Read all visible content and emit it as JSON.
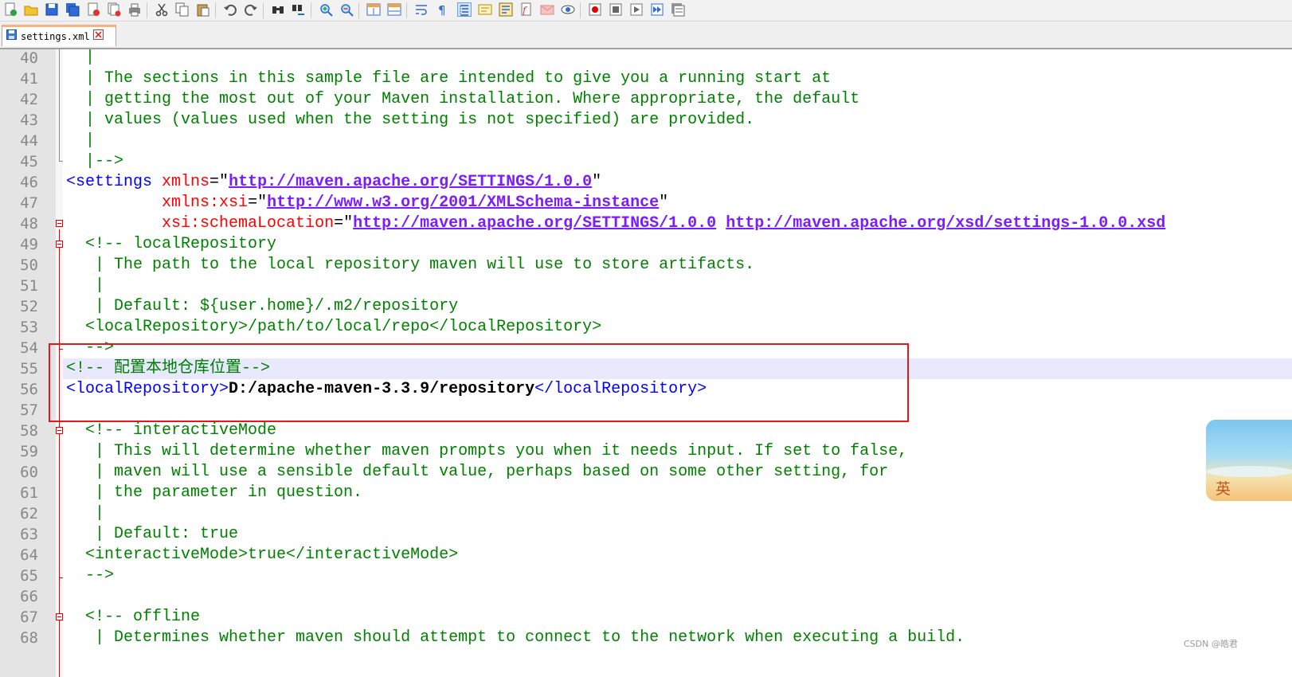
{
  "tab": {
    "filename": "settings.xml"
  },
  "toolbar_icons": [
    "new-file-icon",
    "open-file-icon",
    "save-icon",
    "save-all-icon",
    "close-icon",
    "close-all-icon",
    "print-icon",
    "cut-icon",
    "copy-icon",
    "paste-icon",
    "undo-icon",
    "redo-icon",
    "find-icon",
    "replace-icon",
    "zoom-in-icon",
    "zoom-out-icon",
    "sync-vertical-icon",
    "sync-horizontal-icon",
    "word-wrap-icon",
    "show-all-chars-icon",
    "indent-guide-icon",
    "doc-map-icon",
    "function-list-icon",
    "folder-workspace-icon",
    "monitoring-icon",
    "eye-icon",
    "record-macro-icon",
    "stop-record-icon",
    "play-macro-icon",
    "run-macro-multiple-icon",
    "save-macro-icon"
  ],
  "lines": [
    {
      "n": "40",
      "parts": [
        {
          "t": "  |",
          "c": "cm"
        }
      ]
    },
    {
      "n": "41",
      "parts": [
        {
          "t": "  | The sections in this sample file are intended to give you a running start at",
          "c": "cm"
        }
      ]
    },
    {
      "n": "42",
      "parts": [
        {
          "t": "  | getting the most out of your Maven installation. Where appropriate, the default",
          "c": "cm"
        }
      ]
    },
    {
      "n": "43",
      "parts": [
        {
          "t": "  | values (values used when the setting is not specified) are provided.",
          "c": "cm"
        }
      ]
    },
    {
      "n": "44",
      "parts": [
        {
          "t": "  |",
          "c": "cm"
        }
      ]
    },
    {
      "n": "45",
      "parts": [
        {
          "t": "  |-->",
          "c": "cm"
        }
      ]
    },
    {
      "n": "46",
      "parts": [
        {
          "t": "<settings ",
          "c": "tg"
        },
        {
          "t": "xmlns",
          "c": "at"
        },
        {
          "t": "=\"",
          "c": "eq"
        },
        {
          "t": "http://maven.apache.org/SETTINGS/1.0.0",
          "c": "lk"
        },
        {
          "t": "\"",
          "c": "eq"
        }
      ]
    },
    {
      "n": "47",
      "parts": [
        {
          "t": "          ",
          "c": "eq"
        },
        {
          "t": "xmlns:xsi",
          "c": "at"
        },
        {
          "t": "=\"",
          "c": "eq"
        },
        {
          "t": "http://www.w3.org/2001/XMLSchema-instance",
          "c": "lk"
        },
        {
          "t": "\"",
          "c": "eq"
        }
      ]
    },
    {
      "n": "48",
      "parts": [
        {
          "t": "          ",
          "c": "eq"
        },
        {
          "t": "xsi:schemaLocation",
          "c": "at"
        },
        {
          "t": "=\"",
          "c": "eq"
        },
        {
          "t": "http://maven.apache.org/SETTINGS/1.0.0",
          "c": "lk"
        },
        {
          "t": " ",
          "c": "eq"
        },
        {
          "t": "http://maven.apache.org/xsd/settings-1.0.0.xsd",
          "c": "lk"
        }
      ]
    },
    {
      "n": "49",
      "parts": [
        {
          "t": "  <!-- localRepository",
          "c": "cm"
        }
      ]
    },
    {
      "n": "50",
      "parts": [
        {
          "t": "   | The path to the local repository maven will use to store artifacts.",
          "c": "cm"
        }
      ]
    },
    {
      "n": "51",
      "parts": [
        {
          "t": "   |",
          "c": "cm"
        }
      ]
    },
    {
      "n": "52",
      "parts": [
        {
          "t": "   | Default: ${user.home}/.m2/repository",
          "c": "cm"
        }
      ]
    },
    {
      "n": "53",
      "parts": [
        {
          "t": "  <localRepository>/path/to/local/repo</localRepository>",
          "c": "cm"
        }
      ]
    },
    {
      "n": "54",
      "parts": [
        {
          "t": "  -->",
          "c": "cm"
        }
      ]
    },
    {
      "n": "55",
      "parts": [
        {
          "t": "<!-- 配置本地仓库位置-->",
          "c": "cm"
        }
      ]
    },
    {
      "n": "56",
      "parts": [
        {
          "t": "<localRepository>",
          "c": "tg"
        },
        {
          "t": "D:/apache-maven-3.3.9/repository",
          "c": "bk"
        },
        {
          "t": "</localRepository>",
          "c": "tg"
        }
      ]
    },
    {
      "n": "57",
      "parts": []
    },
    {
      "n": "58",
      "parts": [
        {
          "t": "  <!-- interactiveMode",
          "c": "cm"
        }
      ]
    },
    {
      "n": "59",
      "parts": [
        {
          "t": "   | This will determine whether maven prompts you when it needs input. If set to false,",
          "c": "cm"
        }
      ]
    },
    {
      "n": "60",
      "parts": [
        {
          "t": "   | maven will use a sensible default value, perhaps based on some other setting, for",
          "c": "cm"
        }
      ]
    },
    {
      "n": "61",
      "parts": [
        {
          "t": "   | the parameter in question.",
          "c": "cm"
        }
      ]
    },
    {
      "n": "62",
      "parts": [
        {
          "t": "   |",
          "c": "cm"
        }
      ]
    },
    {
      "n": "63",
      "parts": [
        {
          "t": "   | Default: true",
          "c": "cm"
        }
      ]
    },
    {
      "n": "64",
      "parts": [
        {
          "t": "  <interactiveMode>true</interactiveMode>",
          "c": "cm"
        }
      ]
    },
    {
      "n": "65",
      "parts": [
        {
          "t": "  -->",
          "c": "cm"
        }
      ]
    },
    {
      "n": "66",
      "parts": []
    },
    {
      "n": "67",
      "parts": [
        {
          "t": "  <!-- offline",
          "c": "cm"
        }
      ]
    },
    {
      "n": "68",
      "parts": [
        {
          "t": "   | Determines whether maven should attempt to connect to the network when executing a build.",
          "c": "cm"
        }
      ]
    }
  ],
  "highlighted_line": "55",
  "fold_markers": [
    "48",
    "49",
    "58",
    "67"
  ],
  "ime": {
    "label": "英"
  },
  "watermark": "CSDN @皓君"
}
